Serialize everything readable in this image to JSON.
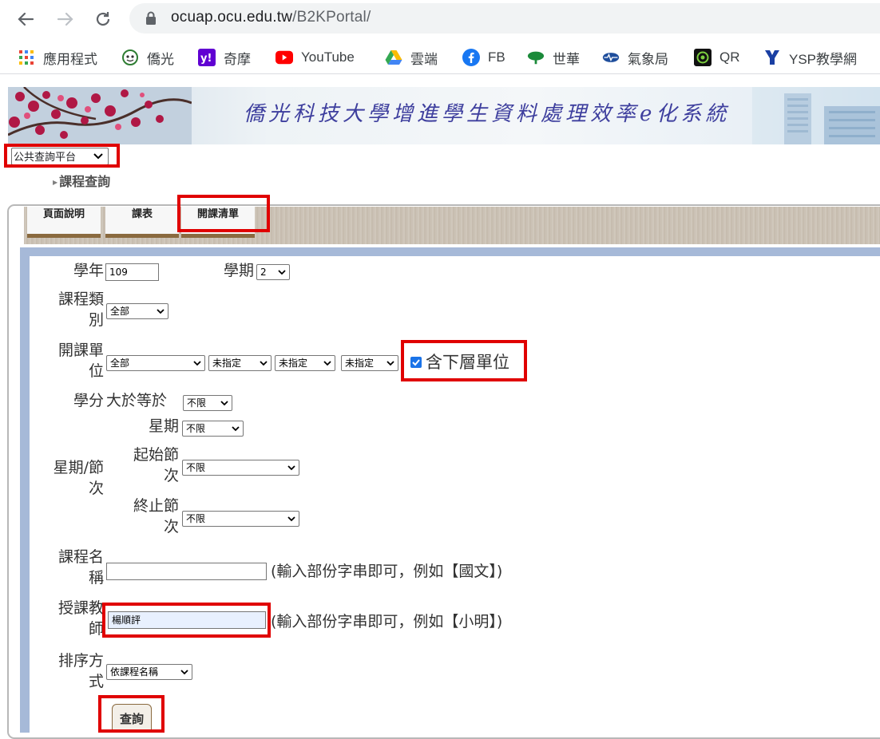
{
  "browser": {
    "url_domain": "ocuap.ocu.edu.tw",
    "url_path": "/B2KPortal/",
    "bookmarks": [
      {
        "label": "應用程式",
        "icon": "apps-grid-icon"
      },
      {
        "label": "僑光",
        "icon": "ocu-logo-icon"
      },
      {
        "label": "奇摩",
        "icon": "yahoo-icon"
      },
      {
        "label": "YouTube",
        "icon": "youtube-icon"
      },
      {
        "label": "雲端",
        "icon": "google-drive-icon"
      },
      {
        "label": "FB",
        "icon": "facebook-icon"
      },
      {
        "label": "世華",
        "icon": "tree-icon"
      },
      {
        "label": "氣象局",
        "icon": "weather-bureau-icon"
      },
      {
        "label": "QR",
        "icon": "qr-icon"
      },
      {
        "label": "YSP教學網",
        "icon": "ysp-icon"
      }
    ]
  },
  "banner": {
    "title": "僑光科技大學增進學生資料處理效率e化系統"
  },
  "platform": {
    "selected": "公共查詢平台"
  },
  "breadcrumb": {
    "label": "課程查詢"
  },
  "tabs": [
    {
      "label": "頁面說明"
    },
    {
      "label": "課表"
    },
    {
      "label": "開課清單"
    }
  ],
  "form": {
    "year_label": "學年",
    "year_value": "109",
    "term_label": "學期",
    "term_value": "2",
    "category_label_1": "課程類",
    "category_label_2": "別",
    "category_value": "全部",
    "unit_label_1": "開課單",
    "unit_label_2": "位",
    "unit_value_1": "全部",
    "unit_value_2": "未指定",
    "unit_value_3": "未指定",
    "unit_value_4": "未指定",
    "include_sub_label": "含下層單位",
    "credit_label": "學分",
    "credit_op": "大於等於",
    "credit_value": "不限",
    "weekday_label": "星期",
    "weekday_value": "不限",
    "section_group_label_1": "星期/節",
    "section_group_label_2": "次",
    "start_label_1": "起始節",
    "start_label_2": "次",
    "start_value": "不限",
    "end_label_1": "終止節",
    "end_label_2": "次",
    "end_value": "不限",
    "course_name_label_1": "課程名",
    "course_name_label_2": "稱",
    "course_name_value": "",
    "course_name_hint": "(輸入部份字串即可，例如【國文】)",
    "teacher_label_1": "授課教",
    "teacher_label_2": "師",
    "teacher_value": "楊順評",
    "teacher_hint": "(輸入部份字串即可，例如【小明】)",
    "sort_label_1": "排序方",
    "sort_label_2": "式",
    "sort_value": "依課程名稱",
    "query_button": "查詢"
  },
  "colors": {
    "highlight": "#e00000",
    "tab_accent": "#8a6a3f",
    "frame_blue": "#a6b9d8"
  }
}
